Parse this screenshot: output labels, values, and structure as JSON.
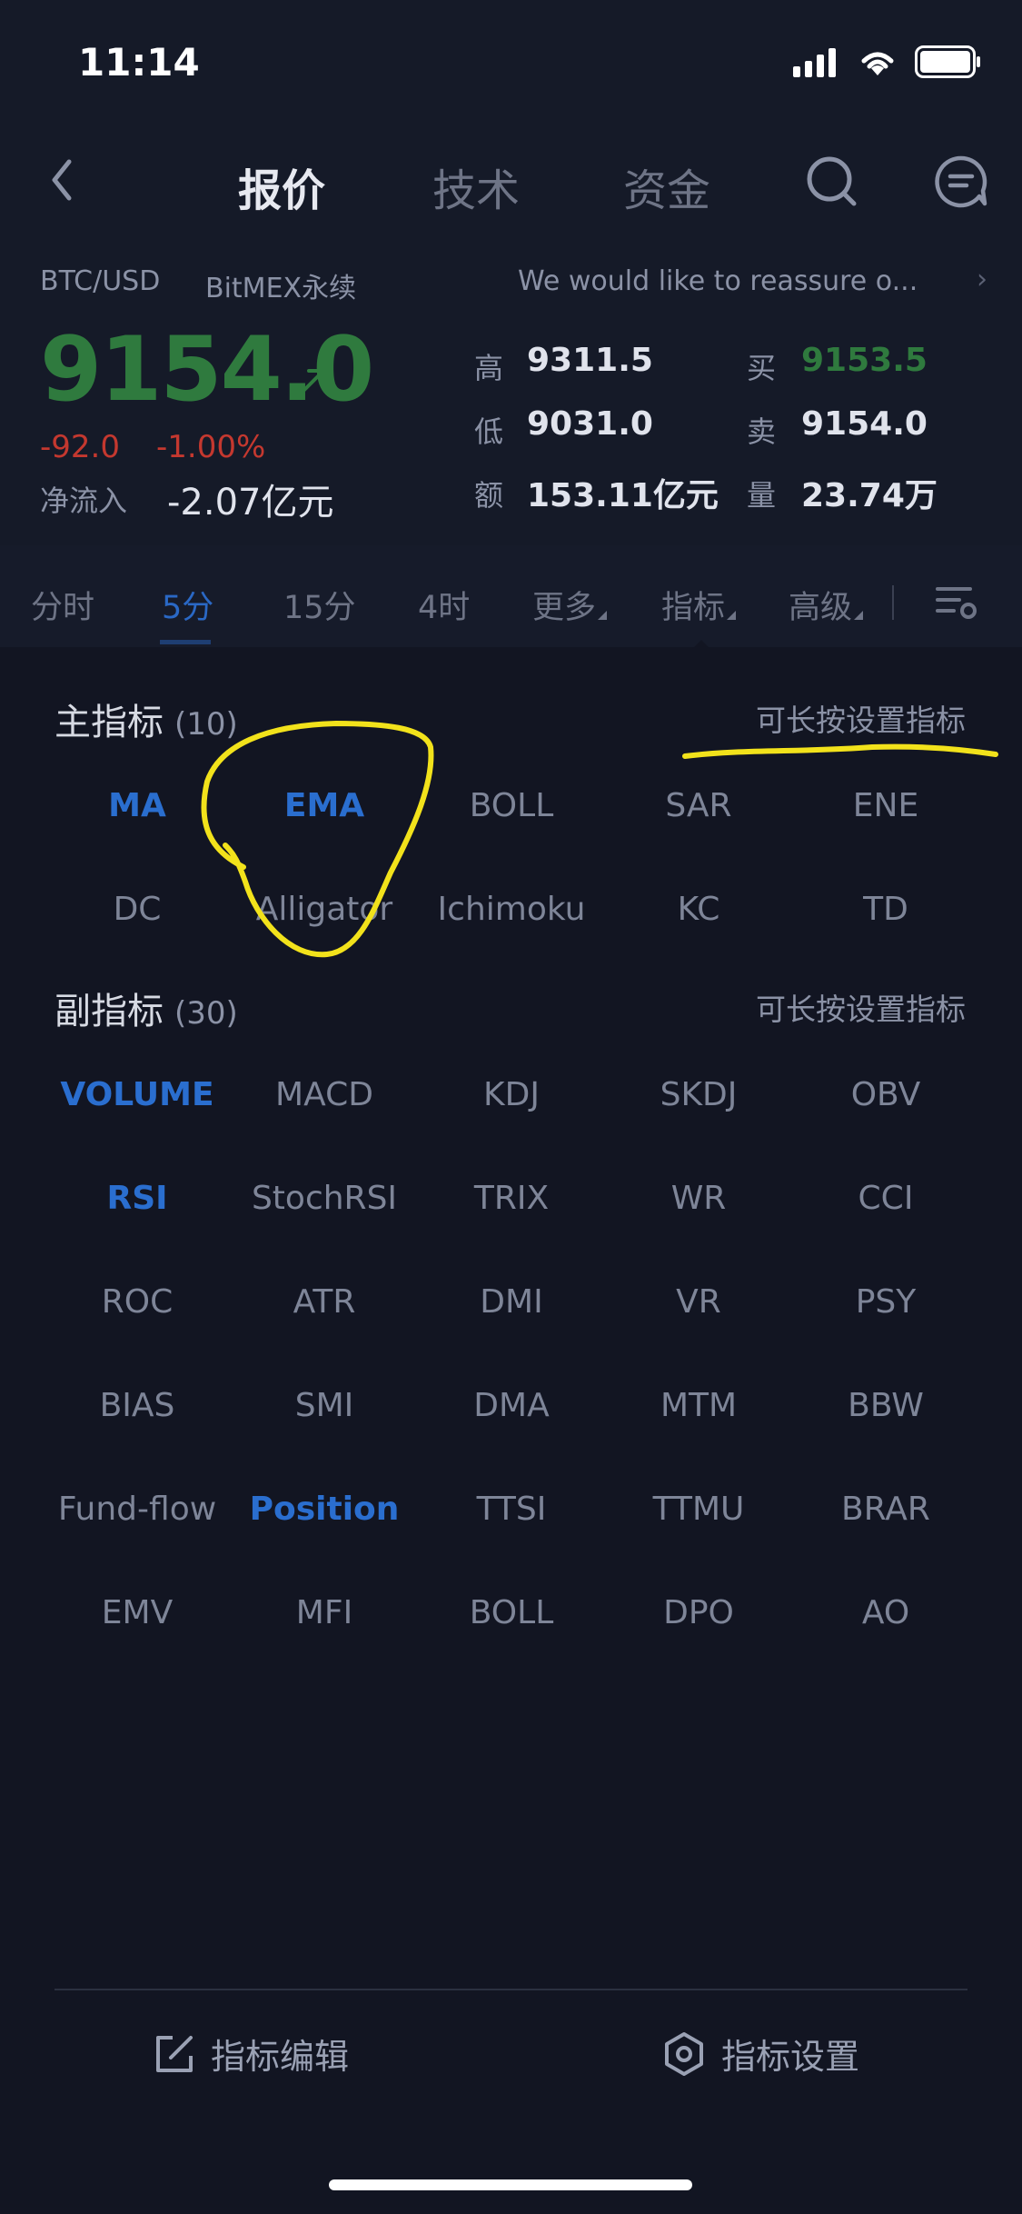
{
  "status_bar": {
    "time": "11:14"
  },
  "nav": {
    "tabs": [
      {
        "label": "报价",
        "active": true
      },
      {
        "label": "技术",
        "active": false
      },
      {
        "label": "资金",
        "active": false
      }
    ]
  },
  "ticker": {
    "pair": "BTC/USD",
    "exchange": "BitMEX永续",
    "news": "We would like to reassure o...",
    "price": "9154.0",
    "change": "-92.0",
    "change_pct": "-1.00%",
    "inflow_label": "净流入",
    "inflow_value": "-2.07亿元",
    "stats": [
      {
        "label": "高",
        "value": "9311.5"
      },
      {
        "label": "买",
        "value": "9153.5"
      },
      {
        "label": "低",
        "value": "9031.0"
      },
      {
        "label": "卖",
        "value": "9154.0"
      },
      {
        "label": "额",
        "value": "153.11亿元"
      },
      {
        "label": "量",
        "value": "23.74万"
      }
    ]
  },
  "periods": [
    "分时",
    "5分",
    "15分",
    "4时",
    "更多",
    "指标",
    "高级"
  ],
  "main_indicators": {
    "title": "主指标",
    "count": "(10)",
    "hint": "可长按设置指标",
    "items": [
      "MA",
      "EMA",
      "BOLL",
      "SAR",
      "ENE",
      "DC",
      "Alligator",
      "Ichimoku",
      "KC",
      "TD"
    ]
  },
  "sub_indicators": {
    "title": "副指标",
    "count": "(30)",
    "hint": "可长按设置指标",
    "items": [
      "VOLUME",
      "MACD",
      "KDJ",
      "SKDJ",
      "OBV",
      "RSI",
      "StochRSI",
      "TRIX",
      "WR",
      "CCI",
      "ROC",
      "ATR",
      "DMI",
      "VR",
      "PSY",
      "BIAS",
      "SMI",
      "DMA",
      "MTM",
      "BBW",
      "Fund-flow",
      "Position",
      "TTSI",
      "TTMU",
      "BRAR",
      "EMV",
      "MFI",
      "BOLL",
      "DPO",
      "AO"
    ]
  },
  "bottom": {
    "edit_label": "指标编辑",
    "settings_label": "指标设置"
  },
  "colors": {
    "accent_blue": "#2a6ecf",
    "price_green": "#2f7a3e",
    "change_red": "#c4382f",
    "annotation_yellow": "#f2e21b"
  }
}
